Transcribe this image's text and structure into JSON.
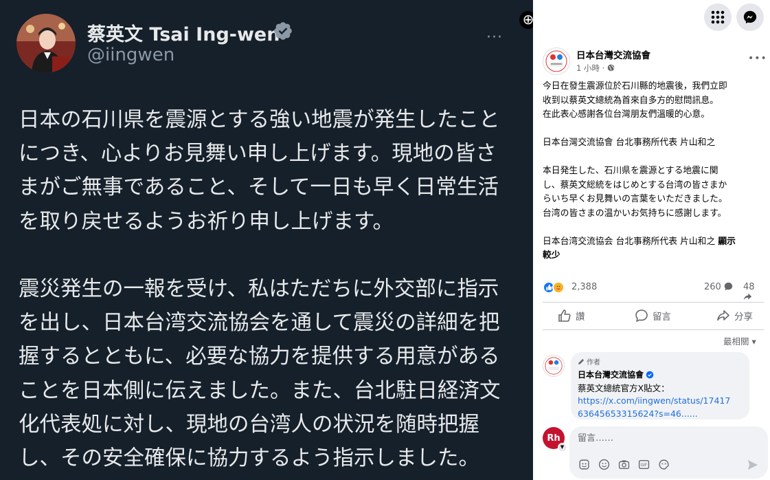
{
  "tweet": {
    "author_name": "蔡英文 Tsai Ing-wen",
    "handle": "@iingwen",
    "more_label": "···",
    "paragraph1": [
      "日本の石川県を震源とする強い地震が発生したこと",
      "につき、心よりお見舞い申し上げます。現地の皆さ",
      "まがご無事であること、そして一日も早く日常生活",
      "を取り戻せるようお祈り申し上げます。"
    ],
    "paragraph2": [
      "震災発生の一報を受け、私はただちに外交部に指示",
      "を出し、日本台湾交流協会を通して震災の詳細を把",
      "握するとともに、必要な協力を提供する用意がある",
      "ことを日本側に伝えました。また、台北駐日経済文",
      "化代表処に対し、現地の台湾人の状況を随時把握",
      "し、その安全確保に協力するよう指示しました。"
    ]
  },
  "facebook": {
    "post": {
      "page_name": "日本台灣交流協會",
      "time": "1 小時 · ",
      "lines_zh": [
        "今日在發生震源位於石川縣的地震後，我們立即",
        "收到以蔡英文總統為首來自多方的慰問訊息。",
        "在此表心感謝各位台灣朋友們溫暖的心意。"
      ],
      "signature_zh": "日本台灣交流協會 台北事務所代表 片山和之",
      "lines_ja": [
        "本日発生した、石川県を震源とする地震に関",
        "し、蔡英文総統をはじめとする台湾の皆さまか",
        "らいち早くお見舞いの言葉をいただきました。",
        "台湾の皆さまの温かいお気持ちに感謝します。"
      ],
      "signature_ja": "日本台湾交流協会 台北事務所代表 片山和之 ",
      "see_more": "顯示",
      "see_more_2": "較少"
    },
    "stats": {
      "reactions": "2,388",
      "comments": "260",
      "shares": "48"
    },
    "actions": {
      "like": "讚",
      "comment": "留言",
      "share": "分享"
    },
    "sort_label": "最相關 ▾",
    "comment": {
      "author_tag": "作者",
      "author": "日本台灣交流協會",
      "text": "蔡英文總統官方X貼文：",
      "link_line1": "https://x.com/iingwen/status/17417",
      "link_line2": "63645653315624?s=46......"
    },
    "composer": {
      "placeholder": "留言……",
      "user_initials": "Rh"
    },
    "colors": {
      "brand_blue": "#0866ff",
      "link": "#216fdb"
    }
  }
}
